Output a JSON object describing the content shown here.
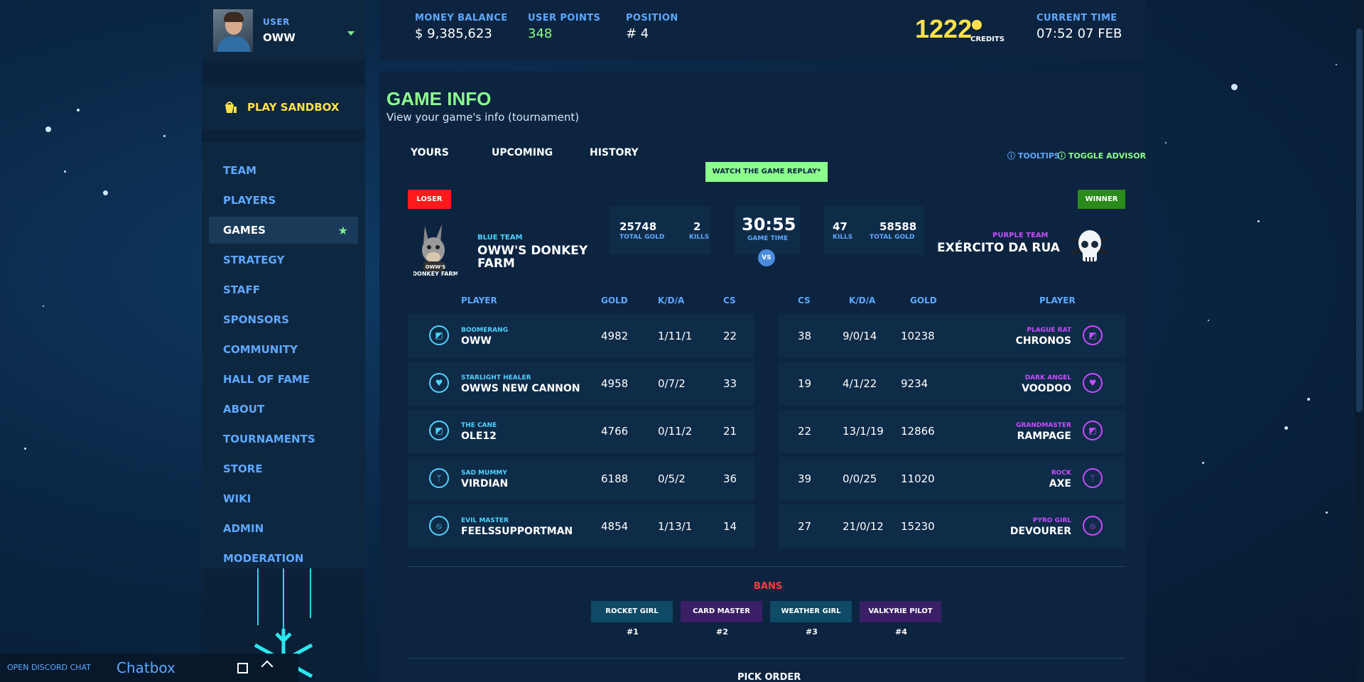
{
  "user": {
    "label": "USER",
    "name": "OWW"
  },
  "sidebar": {
    "play_label": "PLAY SANDBOX",
    "items": [
      {
        "label": "TEAM"
      },
      {
        "label": "PLAYERS"
      },
      {
        "label": "GAMES"
      },
      {
        "label": "STRATEGY"
      },
      {
        "label": "STAFF"
      },
      {
        "label": "SPONSORS"
      },
      {
        "label": "COMMUNITY"
      },
      {
        "label": "HALL OF FAME"
      },
      {
        "label": "ABOUT"
      },
      {
        "label": "TOURNAMENTS"
      },
      {
        "label": "STORE"
      },
      {
        "label": "WIKI"
      },
      {
        "label": "ADMIN"
      },
      {
        "label": "MODERATION"
      }
    ],
    "active_item": "GAMES"
  },
  "chat": {
    "discord": "OPEN DISCORD CHAT",
    "title": "Chatbox"
  },
  "header": {
    "money_label": "MONEY BALANCE",
    "money_value": "$ 9,385,623",
    "points_label": "USER POINTS",
    "points_value": "348",
    "position_label": "POSITION",
    "position_value": "# 4",
    "credits_value": "1222",
    "credits_label": "CREDITS",
    "time_label": "CURRENT TIME",
    "time_value": "07:52 07 FEB"
  },
  "page": {
    "title": "GAME INFO",
    "subtitle": "View your game's info (tournament)",
    "tabs": [
      "YOURS",
      "UPCOMING",
      "HISTORY"
    ],
    "tooltips": "TOOLTIPS",
    "toggle_advisor": "TOGGLE ADVISOR",
    "replay_button": "WATCH THE GAME REPLAY*"
  },
  "colors": {
    "accent_green": "#8cff8c",
    "blue_team": "#4fd3ff",
    "purple_team": "#c94cff",
    "loser": "#ff1a1a",
    "winner": "#2a8a1a"
  },
  "match": {
    "left": {
      "result": "LOSER",
      "side": "BLUE TEAM",
      "name_line1": "OWW'S DONKEY",
      "name_line2": "FARM",
      "total_gold": "25748",
      "kills": "2",
      "logo": "donkey-logo"
    },
    "right": {
      "result": "WINNER",
      "side": "PURPLE TEAM",
      "name": "EXÉRCITO DA RUA",
      "total_gold": "58588",
      "kills": "47",
      "logo": "skull-logo"
    },
    "game_time": "30:55",
    "game_time_label": "GAME TIME",
    "total_gold_label": "TOTAL GOLD",
    "kills_label": "KILLS",
    "vs": "VS"
  },
  "table": {
    "headers_left": {
      "player": "PLAYER",
      "gold": "GOLD",
      "kda": "K/D/A",
      "cs": "CS"
    },
    "headers_right": {
      "cs": "CS",
      "kda": "K/D/A",
      "gold": "GOLD",
      "player": "PLAYER"
    },
    "left_rows": [
      {
        "hero": "BOOMERANG",
        "player": "OWW",
        "gold": "4982",
        "kda": "1/11/1",
        "cs": "22",
        "icon": "sword-icon"
      },
      {
        "hero": "STARLIGHT HEALER",
        "player": "OWWS NEW CANNON",
        "gold": "4958",
        "kda": "0/7/2",
        "cs": "33",
        "icon": "heart-icon"
      },
      {
        "hero": "THE CANE",
        "player": "OLE12",
        "gold": "4766",
        "kda": "0/11/2",
        "cs": "21",
        "icon": "sword-icon"
      },
      {
        "hero": "SAD MUMMY",
        "player": "VIRDIAN",
        "gold": "6188",
        "kda": "0/5/2",
        "cs": "36",
        "icon": "leaf-icon"
      },
      {
        "hero": "EVIL MASTER",
        "player": "FEELSSUPPORTMAN",
        "gold": "4854",
        "kda": "1/13/1",
        "cs": "14",
        "icon": "compass-icon"
      }
    ],
    "right_rows": [
      {
        "hero": "PLAGUE RAT",
        "player": "CHRONOS",
        "gold": "10238",
        "kda": "9/0/14",
        "cs": "38",
        "icon": "sword-icon"
      },
      {
        "hero": "DARK ANGEL",
        "player": "VOODOO",
        "gold": "9234",
        "kda": "4/1/22",
        "cs": "19",
        "icon": "heart-icon"
      },
      {
        "hero": "GRANDMASTER",
        "player": "RAMPAGE",
        "gold": "12866",
        "kda": "13/1/19",
        "cs": "22",
        "icon": "sword-icon"
      },
      {
        "hero": "ROCK",
        "player": "AXE",
        "gold": "11020",
        "kda": "0/0/25",
        "cs": "39",
        "icon": "leaf-icon"
      },
      {
        "hero": "PYRO GIRL",
        "player": "DEVOURER",
        "gold": "15230",
        "kda": "21/0/12",
        "cs": "27",
        "icon": "compass-icon"
      }
    ]
  },
  "bans": {
    "title": "BANS",
    "items": [
      {
        "name": "ROCKET GIRL",
        "num": "#1",
        "color": "#0f4a66"
      },
      {
        "name": "CARD MASTER",
        "num": "#2",
        "color": "#3a1f66"
      },
      {
        "name": "WEATHER GIRL",
        "num": "#3",
        "color": "#0f4a66"
      },
      {
        "name": "VALKYRIE PILOT",
        "num": "#4",
        "color": "#3a1f66"
      }
    ]
  },
  "pick_order_title": "PICK ORDER"
}
